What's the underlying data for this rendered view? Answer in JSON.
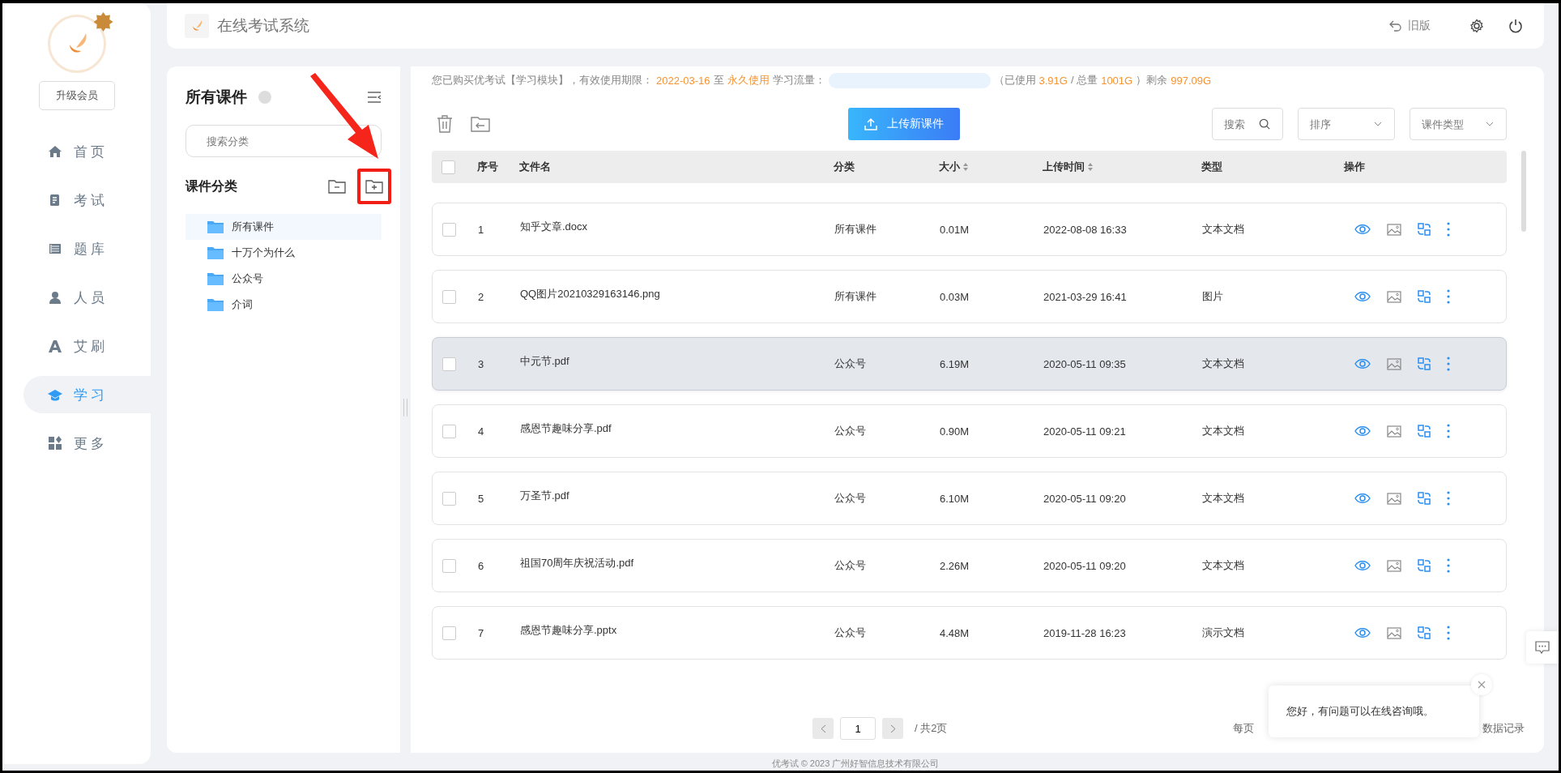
{
  "sidebar": {
    "upgrade_button": "升级会员",
    "items": [
      {
        "label": "首页",
        "kind": "home",
        "selected": false
      },
      {
        "label": "考试",
        "kind": "exam",
        "selected": false
      },
      {
        "label": "题库",
        "kind": "bank",
        "selected": false
      },
      {
        "label": "人员",
        "kind": "person",
        "selected": false
      },
      {
        "label": "艾刷",
        "kind": "letter",
        "selected": false
      },
      {
        "label": "学习",
        "kind": "cap",
        "selected": true
      },
      {
        "label": "更多",
        "kind": "grid",
        "selected": false
      }
    ]
  },
  "header": {
    "title": "在线考试系统",
    "old_version": "旧版"
  },
  "category_panel": {
    "title": "所有课件",
    "search": {
      "placeholder": "搜索分类"
    },
    "section_title": "课件分类",
    "tree": [
      {
        "label": "所有课件",
        "selected": true
      },
      {
        "label": "十万个为什么",
        "selected": false
      },
      {
        "label": "公众号",
        "selected": false
      },
      {
        "label": "介词",
        "selected": false
      }
    ]
  },
  "info_bar": {
    "prefix": "您已购买优考试【学习模块】，有效使用期限：",
    "start": "2022-03-16",
    "to": "至",
    "end": "永久使用",
    "traffic_label": "学习流量：",
    "usage_open": "（已使用",
    "used": "3.91G",
    "slash": " / 总量",
    "total": "1001G",
    "usage_close": "）剩余",
    "remaining": "997.09G"
  },
  "toolbar": {
    "upload_button": "上传新课件",
    "search": {
      "placeholder": "搜索"
    },
    "sort": {
      "placeholder": "排序"
    },
    "type_filter": {
      "placeholder": "课件类型"
    }
  },
  "table": {
    "select_all_checked": false,
    "columns": [
      {
        "label": "序号",
        "sortable": false
      },
      {
        "label": "文件名",
        "sortable": false
      },
      {
        "label": "分类",
        "sortable": false
      },
      {
        "label": "大小",
        "sortable": true
      },
      {
        "label": "上传时间",
        "sortable": true
      },
      {
        "label": "类型",
        "sortable": false
      },
      {
        "label": "操作",
        "sortable": false
      }
    ],
    "rows": [
      {
        "index": "1",
        "name": "知乎文章.docx",
        "category": "所有课件",
        "size": "0.01M",
        "time": "2022-08-08 16:33",
        "type": "文本文档",
        "hovered": false
      },
      {
        "index": "2",
        "name": "QQ图片20210329163146.png",
        "category": "所有课件",
        "size": "0.03M",
        "time": "2021-03-29 16:41",
        "type": "图片",
        "hovered": false
      },
      {
        "index": "3",
        "name": "中元节.pdf",
        "category": "公众号",
        "size": "6.19M",
        "time": "2020-05-11 09:35",
        "type": "文本文档",
        "hovered": true
      },
      {
        "index": "4",
        "name": "感恩节趣味分享.pdf",
        "category": "公众号",
        "size": "0.90M",
        "time": "2020-05-11 09:21",
        "type": "文本文档",
        "hovered": false
      },
      {
        "index": "5",
        "name": "万圣节.pdf",
        "category": "公众号",
        "size": "6.10M",
        "time": "2020-05-11 09:20",
        "type": "文本文档",
        "hovered": false
      },
      {
        "index": "6",
        "name": "祖国70周年庆祝活动.pdf",
        "category": "公众号",
        "size": "2.26M",
        "time": "2020-05-11 09:20",
        "type": "文本文档",
        "hovered": false
      },
      {
        "index": "7",
        "name": "感恩节趣味分享.pptx",
        "category": "公众号",
        "size": "4.48M",
        "time": "2019-11-28 16:23",
        "type": "演示文档",
        "hovered": false
      }
    ]
  },
  "pagination": {
    "page": "1",
    "total_pages": "/ 共2页",
    "per_page_label": "每页",
    "records_label": "数据记录"
  },
  "chat_popup": {
    "message": "您好，有问题可以在线咨询哦。"
  },
  "footer": "优考试 © 2023 广州好智信息技术有限公司"
}
